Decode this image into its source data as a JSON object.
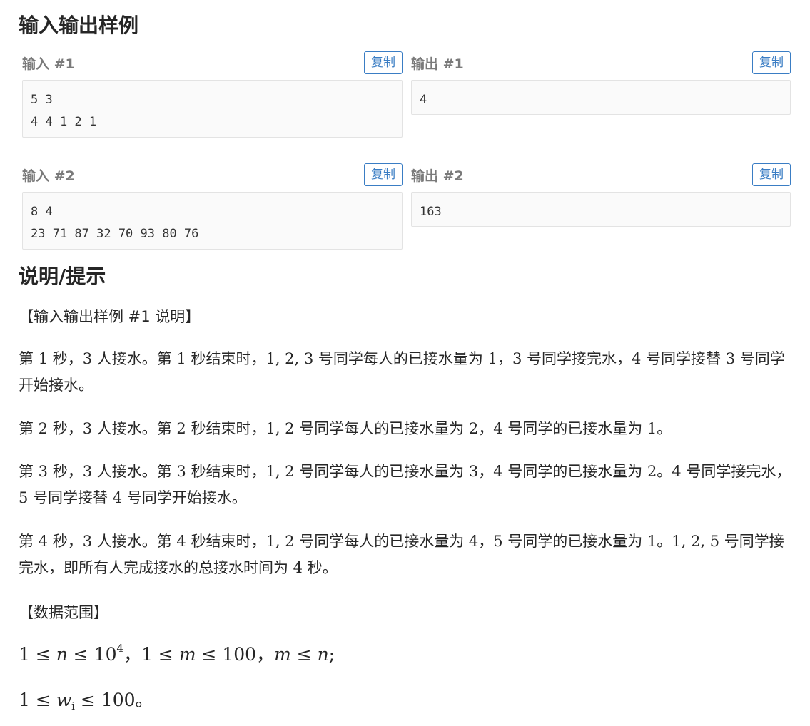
{
  "samples_title": "输入输出样例",
  "copy_label": "复制",
  "samples": [
    {
      "input_label": "输入 #1",
      "input": "5 3\n4 4 1 2 1",
      "output_label": "输出 #1",
      "output": "4"
    },
    {
      "input_label": "输入 #2",
      "input": "8 4\n23 71 87 32 70 93 80 76",
      "output_label": "输出 #2",
      "output": "163"
    }
  ],
  "hint_title": "说明/提示",
  "hint": {
    "sample_note_heading": "【输入输出样例 #1 说明】",
    "paragraphs": [
      "第 1 秒，3 人接水。第 1 秒结束时，1, 2, 3 号同学每人的已接水量为 1，3 号同学接完水，4 号同学接替 3 号同学开始接水。",
      "第 2 秒，3 人接水。第 2 秒结束时，1, 2 号同学每人的已接水量为 2，4 号同学的已接水量为 1。",
      "第 3 秒，3 人接水。第 3 秒结束时，1, 2 号同学每人的已接水量为 3，4 号同学的已接水量为 2。4 号同学接完水，5 号同学接替 4 号同学开始接水。",
      "第 4 秒，3 人接水。第 4 秒结束时，1, 2 号同学每人的已接水量为 4，5 号同学的已接水量为 1。1, 2, 5 号同学接完水，即所有人完成接水的总接水时间为 4 秒。"
    ],
    "range_heading": "【数据范围】",
    "range_line1": {
      "a": "1 ≤ ",
      "n": "n",
      "b": " ≤ 10",
      "exp": "4",
      "c": "，1 ≤ ",
      "m": "m",
      "d": " ≤ 100，",
      "m2": "m",
      "e": " ≤ ",
      "n2": "n",
      "f": ";"
    },
    "range_line2": {
      "a": "1 ≤ ",
      "w": "w",
      "sub": "i",
      "b": " ≤ 100。"
    }
  }
}
